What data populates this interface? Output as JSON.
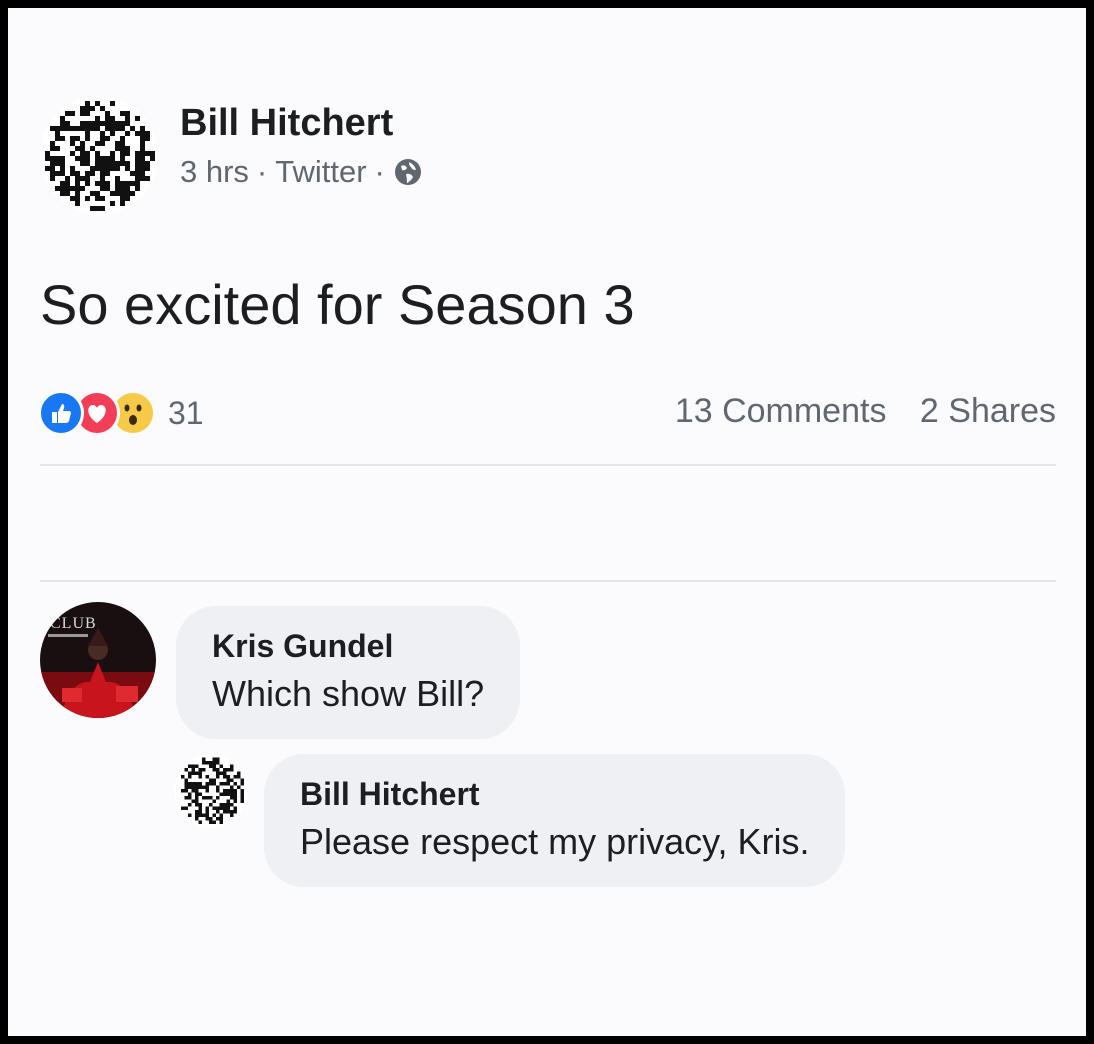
{
  "post": {
    "author": "Bill Hitchert",
    "time": "3 hrs",
    "separator": "·",
    "source": "Twitter",
    "privacy_icon": "globe-icon",
    "text": "So excited for Season 3"
  },
  "reactions": {
    "icons": [
      "like-icon",
      "love-icon",
      "wow-icon"
    ],
    "count": "31",
    "comments_label": "13 Comments",
    "shares_label": "2 Shares"
  },
  "comments": [
    {
      "name": "Kris Gundel",
      "text": "Which show Bill?",
      "avatar_text": "CLUB",
      "reply": {
        "name": "Bill Hitchert",
        "text": "Please respect my privacy, Kris."
      }
    }
  ],
  "colors": {
    "like": "#1877f2",
    "love": "#f33e58",
    "wow": "#f7b125",
    "bubble": "#eef0f3",
    "secondary_text": "#606770"
  }
}
